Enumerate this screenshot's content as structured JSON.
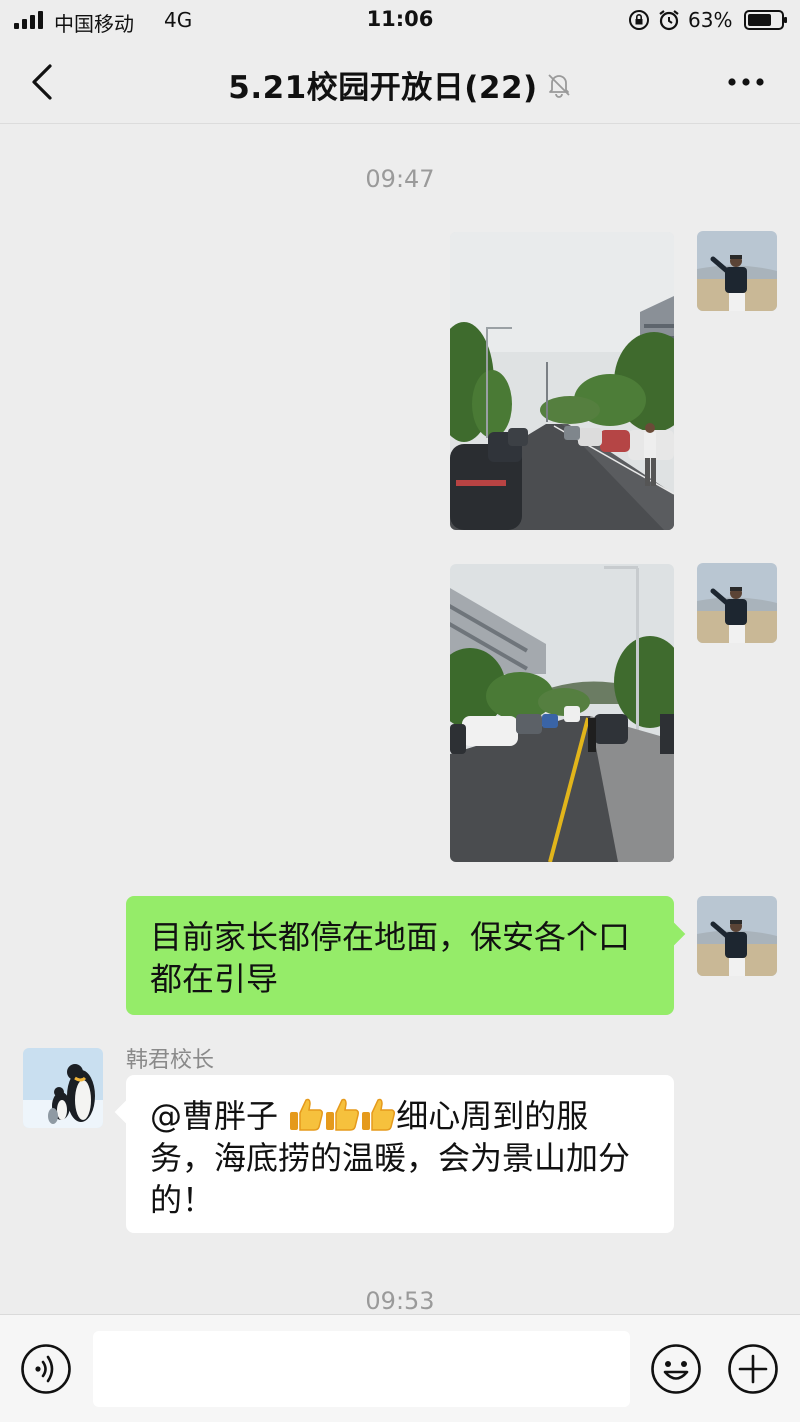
{
  "status_bar": {
    "carrier": "中国移动",
    "network": "4G",
    "time": "11:06",
    "battery": "63%",
    "icons": [
      "signal-icon",
      "lock-rotation-icon",
      "alarm-icon",
      "battery-icon"
    ]
  },
  "nav": {
    "title": "5.21校园开放日(22)",
    "back_icon": "chevron-left-icon",
    "mute_icon": "bell-muted-icon",
    "more_icon": "more-dots-icon"
  },
  "messages": {
    "time1": "09:47",
    "text_msg": "目前家长都停在地面，保安各个口都在引导",
    "sender_name": "韩君校长",
    "reply_mention": "@曹胖子",
    "reply_text": "细心周到的服务，海底捞的温暖，会为景山加分的！",
    "reply_emoji": "thumbs-up-icon",
    "time2": "09:53"
  },
  "input_bar": {
    "voice_icon": "voice-icon",
    "emoji_icon": "emoji-face-icon",
    "plus_icon": "plus-circle-icon",
    "value": ""
  },
  "colors": {
    "background": "#ededed",
    "bubble_self": "#95ec69",
    "bubble_other": "#ffffff",
    "timestamp": "#9a9a9a"
  }
}
